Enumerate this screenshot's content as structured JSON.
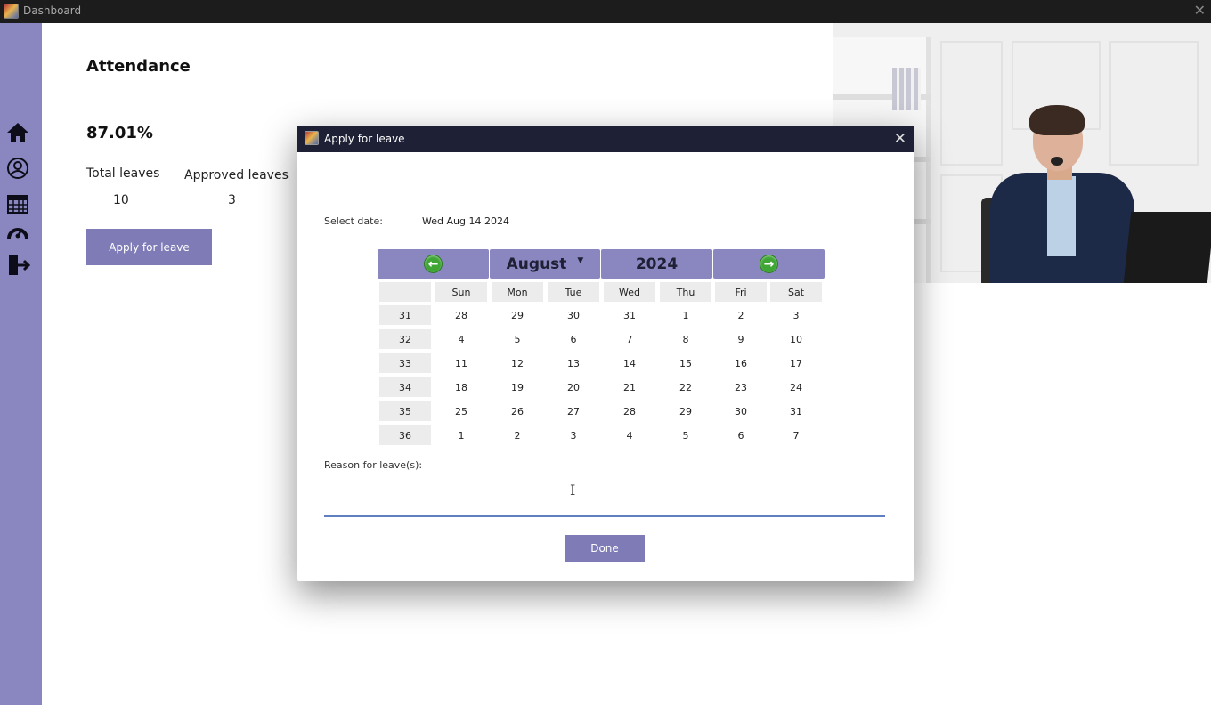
{
  "window": {
    "title": "Dashboard",
    "close_icon": "✕"
  },
  "sidebar": {
    "items": [
      {
        "name": "home-icon"
      },
      {
        "name": "profile-icon"
      },
      {
        "name": "calendar-icon"
      },
      {
        "name": "dashboard-gauge-icon"
      },
      {
        "name": "logout-icon"
      }
    ]
  },
  "main": {
    "title": "Attendance",
    "percentage": "87.01%",
    "total_leaves_label": "Total leaves",
    "total_leaves_value": "10",
    "approved_leaves_label": "Approved leaves",
    "approved_leaves_value": "3",
    "apply_button": "Apply for leave"
  },
  "dialog": {
    "title": "Apply for leave",
    "close_icon": "✕",
    "select_date_label": "Select date:",
    "selected_date": "Wed Aug 14 2024",
    "calendar": {
      "month": "August",
      "year": "2024",
      "prev_icon": "←",
      "next_icon": "→",
      "dropdown_icon": "▼",
      "day_headers": [
        "Sun",
        "Mon",
        "Tue",
        "Wed",
        "Thu",
        "Fri",
        "Sat"
      ],
      "weeks": [
        {
          "week": "31",
          "days": [
            "28",
            "29",
            "30",
            "31",
            "1",
            "2",
            "3"
          ]
        },
        {
          "week": "32",
          "days": [
            "4",
            "5",
            "6",
            "7",
            "8",
            "9",
            "10"
          ]
        },
        {
          "week": "33",
          "days": [
            "11",
            "12",
            "13",
            "14",
            "15",
            "16",
            "17"
          ]
        },
        {
          "week": "34",
          "days": [
            "18",
            "19",
            "20",
            "21",
            "22",
            "23",
            "24"
          ]
        },
        {
          "week": "35",
          "days": [
            "25",
            "26",
            "27",
            "28",
            "29",
            "30",
            "31"
          ]
        },
        {
          "week": "36",
          "days": [
            "1",
            "2",
            "3",
            "4",
            "5",
            "6",
            "7"
          ]
        }
      ]
    },
    "reason_label": "Reason for leave(s):",
    "reason_value": "",
    "done_button": "Done"
  },
  "colors": {
    "accent": "#7f7bb6",
    "sidebar": "#8a87c0",
    "nav_green": "#3fa534",
    "titlebar": "#1e2035"
  }
}
